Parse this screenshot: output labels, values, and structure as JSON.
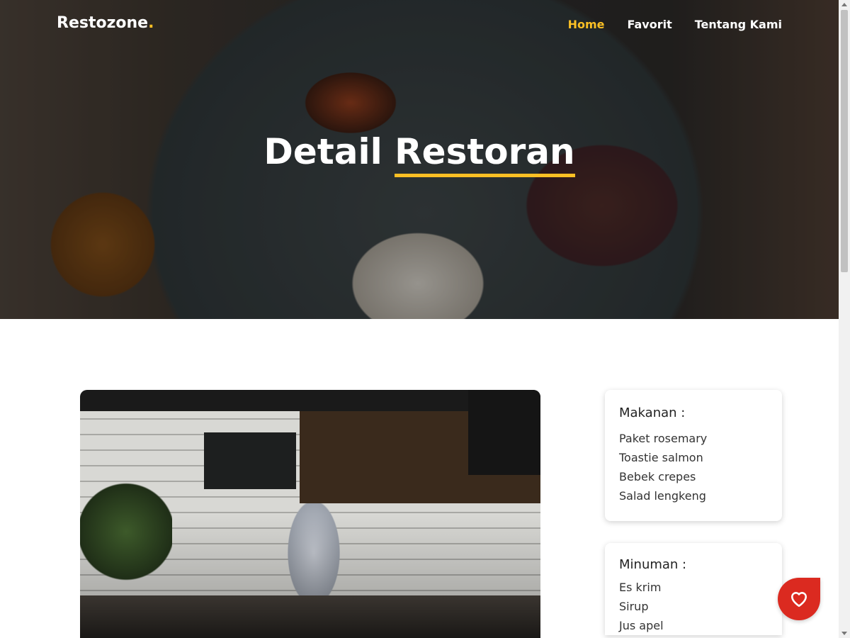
{
  "brand": {
    "name": "Restozone",
    "dot": ".",
    "accent": "#fbbf24"
  },
  "nav": {
    "items": [
      {
        "label": "Home",
        "active": true
      },
      {
        "label": "Favorit"
      },
      {
        "label": "Tentang Kami"
      }
    ]
  },
  "hero": {
    "title_a": "Detail ",
    "title_b": "Restoran"
  },
  "menu": {
    "foods": {
      "title": "Makanan :",
      "items": [
        "Paket rosemary",
        "Toastie salmon",
        "Bebek crepes",
        "Salad lengkeng"
      ]
    },
    "drinks": {
      "title": "Minuman :",
      "items": [
        "Es krim",
        "Sirup",
        "Jus apel"
      ]
    }
  },
  "favorite_button": {
    "icon": "heart-icon",
    "color": "#db2a20"
  }
}
